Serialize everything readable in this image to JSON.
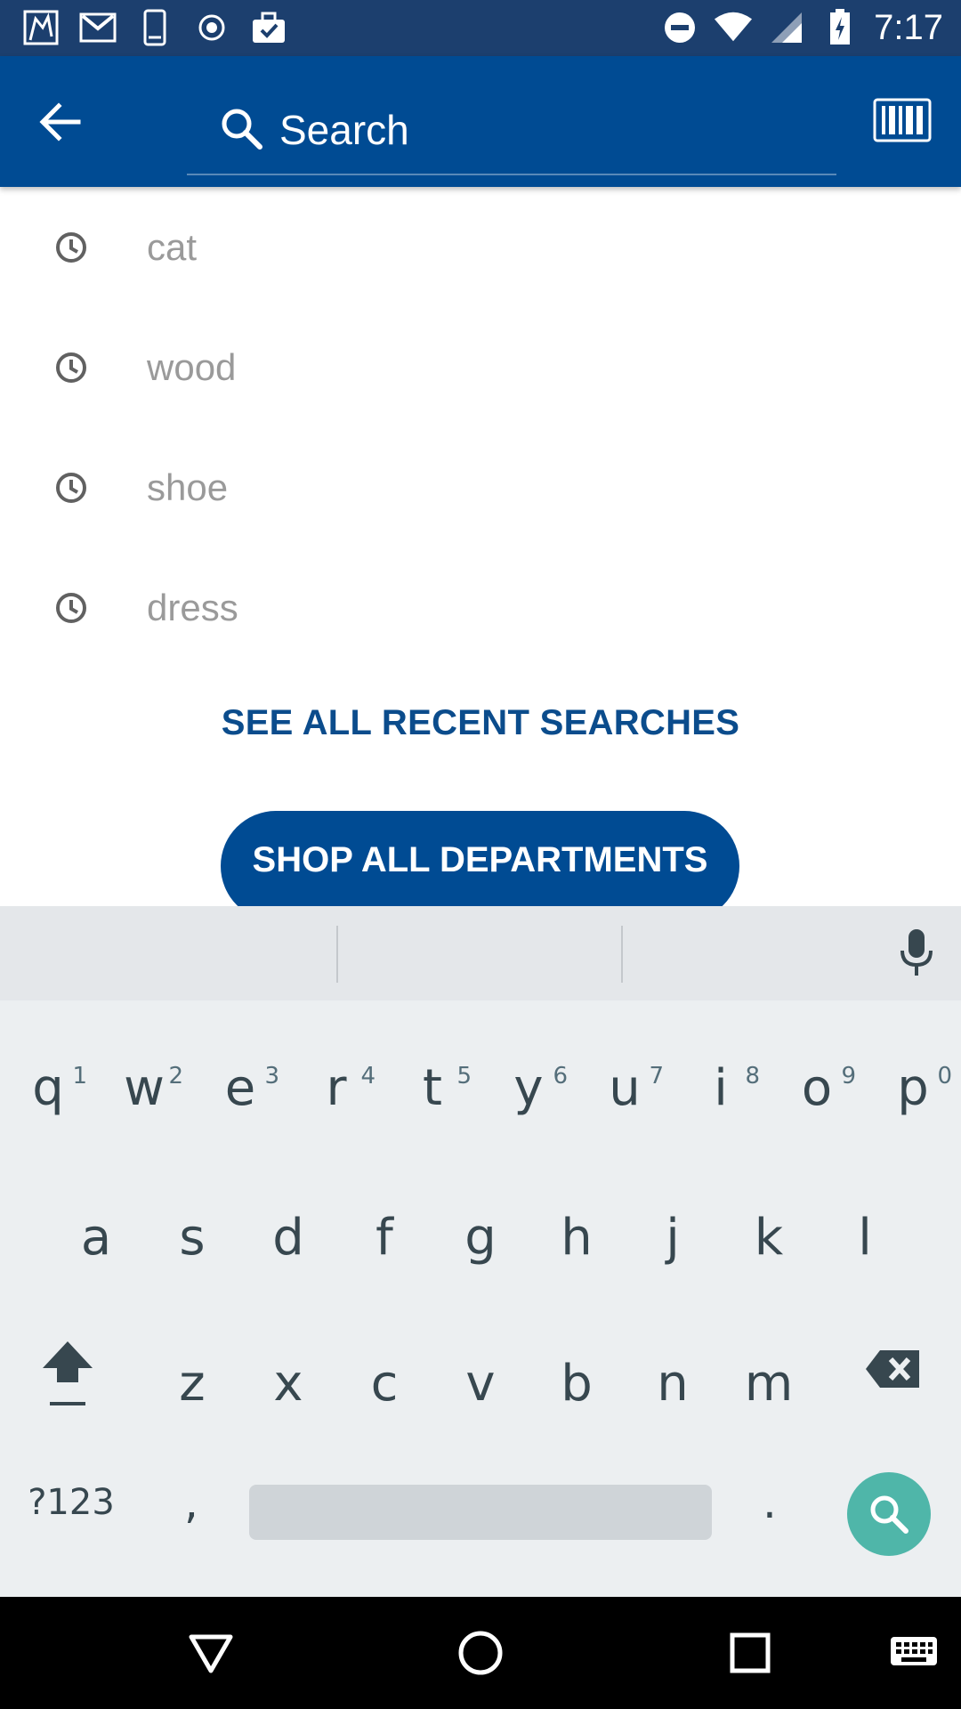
{
  "status_bar": {
    "time": "7:17",
    "left_icons": [
      "app-notification-icon",
      "gmail-icon",
      "phone-icon",
      "record-icon",
      "briefcase-check-icon"
    ],
    "right_icons": [
      "do-not-disturb-icon",
      "wifi-icon",
      "signal-icon",
      "battery-charging-icon"
    ]
  },
  "app_bar": {
    "back_icon": "arrow-left-icon",
    "search_placeholder": "Search",
    "barcode_icon": "barcode-icon",
    "colors": {
      "primary": "#004b93",
      "status_bar": "#1c3f6e"
    }
  },
  "recent_searches": [
    {
      "label": "cat",
      "icon": "clock-icon"
    },
    {
      "label": "wood",
      "icon": "clock-icon"
    },
    {
      "label": "shoe",
      "icon": "clock-icon"
    },
    {
      "label": "dress",
      "icon": "clock-icon"
    }
  ],
  "see_all_label": "SEE ALL RECENT SEARCHES",
  "shop_all_label": "SHOP ALL DEPARTMENTS",
  "keyboard": {
    "row1": [
      {
        "ch": "q",
        "num": "1"
      },
      {
        "ch": "w",
        "num": "2"
      },
      {
        "ch": "e",
        "num": "3"
      },
      {
        "ch": "r",
        "num": "4"
      },
      {
        "ch": "t",
        "num": "5"
      },
      {
        "ch": "y",
        "num": "6"
      },
      {
        "ch": "u",
        "num": "7"
      },
      {
        "ch": "i",
        "num": "8"
      },
      {
        "ch": "o",
        "num": "9"
      },
      {
        "ch": "p",
        "num": "0"
      }
    ],
    "row2": [
      "a",
      "s",
      "d",
      "f",
      "g",
      "h",
      "j",
      "k",
      "l"
    ],
    "row3": [
      "z",
      "x",
      "c",
      "v",
      "b",
      "n",
      "m"
    ],
    "symbols_label": "?123",
    "comma": ",",
    "period": ".",
    "accent_color": "#4fb6a9"
  },
  "nav_bar": {
    "icons": [
      "back-triangle-icon",
      "home-circle-icon",
      "recents-square-icon",
      "keyboard-switch-icon"
    ]
  }
}
